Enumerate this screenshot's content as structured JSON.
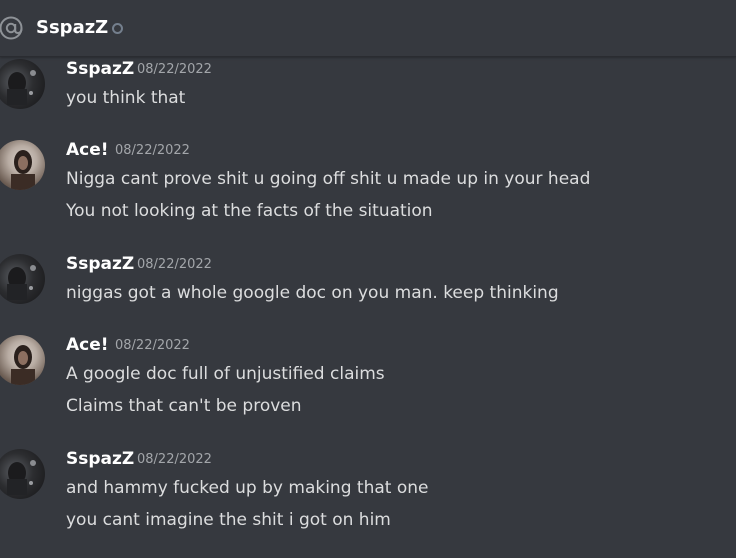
{
  "header": {
    "name": "SspazZ",
    "at_icon": "at-sign-icon",
    "status_icon": "offline-status-icon"
  },
  "messages": [
    {
      "author": "SspazZ",
      "timestamp": "08/22/2022",
      "lines": [
        "you think that"
      ]
    },
    {
      "author": "Ace!",
      "timestamp": "08/22/2022",
      "lines": [
        "Nigga cant prove shit u going off shit u made up in your head",
        "You not looking at the facts of the situation"
      ]
    },
    {
      "author": "SspazZ",
      "timestamp": "08/22/2022",
      "lines": [
        "niggas got a whole google doc on you man. keep thinking"
      ]
    },
    {
      "author": "Ace!",
      "timestamp": "08/22/2022",
      "lines": [
        "A google doc full of unjustified claims",
        "Claims that can't be proven"
      ]
    },
    {
      "author": "SspazZ",
      "timestamp": "08/22/2022",
      "lines": [
        "and hammy fucked up by making that one",
        "you cant imagine the shit i got on him"
      ]
    }
  ]
}
